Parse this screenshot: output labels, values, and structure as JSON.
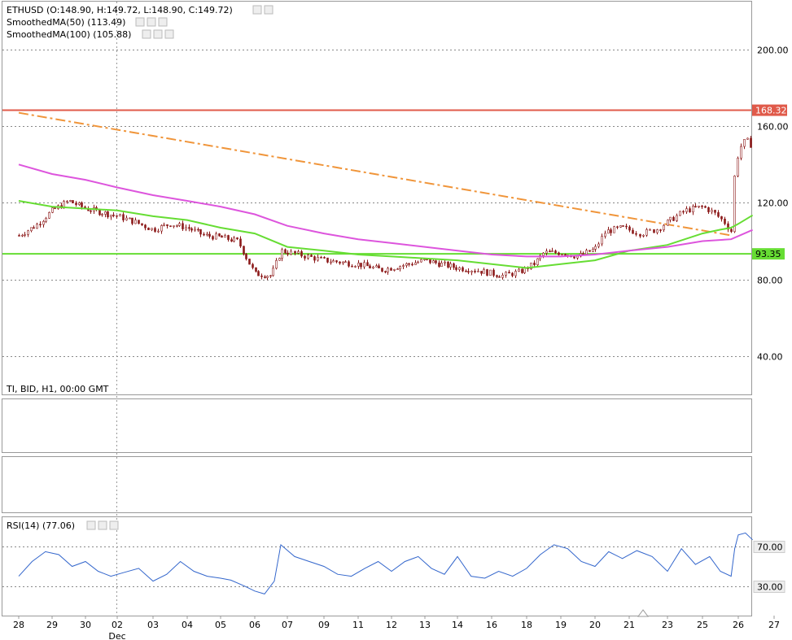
{
  "main_panel": {
    "legend": [
      {
        "text": "ETHUSD (O:148.90, H:149.72, L:148.90, C:149.72)"
      },
      {
        "text": "SmoothedMA(50) (113.49)"
      },
      {
        "text": "SmoothedMA(100) (105.88)"
      }
    ],
    "footer": "TI, BID, H1, 00:00 GMT"
  },
  "rsi_panel": {
    "legend": "RSI(14) (77.06)"
  },
  "colors": {
    "candle": "#8c1a1a",
    "ma50": "#66dd33",
    "ma100": "#dd55dd",
    "trendline": "#f0953a",
    "resistance": "#e05a4a",
    "support": "#66dd33",
    "rsi": "#3366cc",
    "grid": "#888888",
    "frame": "#999999"
  },
  "chart_data": [
    {
      "type": "candlestick",
      "panel": "main",
      "symbol": "ETHUSD",
      "timeframe": "H1",
      "ylim": [
        20,
        225
      ],
      "yticks": [
        40,
        80,
        120,
        160,
        200
      ],
      "ytick_labels": [
        "40.00",
        "80.00",
        "120.00",
        "160.00",
        "200.00"
      ],
      "grid": true,
      "x_dates": [
        "28",
        "29",
        "30",
        "02",
        "03",
        "04",
        "05",
        "06",
        "07",
        "09",
        "11",
        "12",
        "13",
        "14",
        "16",
        "18",
        "19",
        "20",
        "21",
        "23",
        "25",
        "26",
        "27"
      ],
      "x_sublabels": {
        "02": "Dec"
      },
      "price_path": [
        [
          0.0,
          103
        ],
        [
          0.5,
          108
        ],
        [
          1.0,
          116
        ],
        [
          1.5,
          121
        ],
        [
          2.0,
          117
        ],
        [
          2.5,
          115
        ],
        [
          3.0,
          113
        ],
        [
          3.5,
          110
        ],
        [
          4.0,
          106
        ],
        [
          4.5,
          109
        ],
        [
          5.0,
          107
        ],
        [
          5.5,
          103
        ],
        [
          6.0,
          102
        ],
        [
          6.5,
          100
        ],
        [
          7.0,
          83
        ],
        [
          7.5,
          82
        ],
        [
          7.8,
          95
        ],
        [
          8.3,
          93
        ],
        [
          9.0,
          90
        ],
        [
          10.0,
          88
        ],
        [
          10.7,
          85
        ],
        [
          11.5,
          88
        ],
        [
          12.0,
          90
        ],
        [
          13.0,
          86
        ],
        [
          13.5,
          85
        ],
        [
          14.3,
          82
        ],
        [
          14.8,
          84
        ],
        [
          15.2,
          88
        ],
        [
          15.5,
          94
        ],
        [
          16.0,
          94
        ],
        [
          16.5,
          92
        ],
        [
          17.0,
          96
        ],
        [
          17.3,
          105
        ],
        [
          17.8,
          107
        ],
        [
          18.3,
          104
        ],
        [
          18.7,
          106
        ],
        [
          19.0,
          110
        ],
        [
          19.5,
          116
        ],
        [
          20.0,
          118
        ],
        [
          20.3,
          115
        ],
        [
          20.6,
          110
        ],
        [
          20.8,
          105
        ],
        [
          20.85,
          130
        ],
        [
          21.0,
          148
        ],
        [
          21.2,
          153
        ],
        [
          21.4,
          149
        ]
      ],
      "resistance_line": {
        "value": 168.32,
        "label": "168.32"
      },
      "support_line": {
        "value": 93.35,
        "label": "93.35"
      },
      "trendline": {
        "from": [
          0.0,
          167
        ],
        "to": [
          20.8,
          103
        ]
      },
      "series": [
        {
          "name": "SmoothedMA(50)",
          "last": 113.49,
          "points": [
            [
              0.0,
              121
            ],
            [
              1.0,
              118
            ],
            [
              2.0,
              117
            ],
            [
              3.0,
              116
            ],
            [
              4.0,
              113
            ],
            [
              5.0,
              111
            ],
            [
              6.0,
              107
            ],
            [
              7.0,
              104
            ],
            [
              8.0,
              97
            ],
            [
              9.0,
              95
            ],
            [
              10.0,
              93
            ],
            [
              11.0,
              92
            ],
            [
              12.0,
              91
            ],
            [
              13.0,
              90
            ],
            [
              14.0,
              88
            ],
            [
              15.0,
              86
            ],
            [
              16.0,
              88
            ],
            [
              17.0,
              90
            ],
            [
              18.0,
              95
            ],
            [
              19.0,
              98
            ],
            [
              20.0,
              104
            ],
            [
              20.5,
              106
            ],
            [
              20.8,
              107
            ],
            [
              21.0,
              109
            ],
            [
              21.4,
              113.49
            ]
          ]
        },
        {
          "name": "SmoothedMA(100)",
          "last": 105.88,
          "points": [
            [
              0.0,
              140
            ],
            [
              1.0,
              135
            ],
            [
              2.0,
              132
            ],
            [
              3.0,
              128
            ],
            [
              4.0,
              124
            ],
            [
              5.0,
              121
            ],
            [
              6.0,
              118
            ],
            [
              7.0,
              114
            ],
            [
              8.0,
              108
            ],
            [
              9.0,
              104
            ],
            [
              10.0,
              101
            ],
            [
              11.0,
              99
            ],
            [
              12.0,
              97
            ],
            [
              13.0,
              95
            ],
            [
              14.0,
              93
            ],
            [
              15.0,
              92
            ],
            [
              16.0,
              92
            ],
            [
              17.0,
              93
            ],
            [
              18.0,
              95
            ],
            [
              19.0,
              97
            ],
            [
              20.0,
              100
            ],
            [
              20.8,
              101
            ],
            [
              21.4,
              105.88
            ]
          ]
        }
      ]
    },
    {
      "type": "line",
      "panel": "rsi",
      "name": "RSI(14)",
      "last": 77.06,
      "ylim": [
        0,
        100
      ],
      "levels": [
        {
          "value": 70,
          "label": "70.00"
        },
        {
          "value": 30,
          "label": "30.00"
        }
      ],
      "grid": true,
      "points": [
        [
          0.0,
          40
        ],
        [
          0.4,
          55
        ],
        [
          0.8,
          65
        ],
        [
          1.2,
          62
        ],
        [
          1.6,
          50
        ],
        [
          2.0,
          55
        ],
        [
          2.4,
          45
        ],
        [
          2.8,
          40
        ],
        [
          3.2,
          44
        ],
        [
          3.6,
          48
        ],
        [
          4.0,
          35
        ],
        [
          4.4,
          42
        ],
        [
          4.8,
          55
        ],
        [
          5.2,
          45
        ],
        [
          5.6,
          40
        ],
        [
          6.0,
          38
        ],
        [
          6.3,
          36
        ],
        [
          6.7,
          30
        ],
        [
          7.0,
          25
        ],
        [
          7.3,
          22
        ],
        [
          7.6,
          35
        ],
        [
          7.8,
          72
        ],
        [
          8.2,
          60
        ],
        [
          8.6,
          55
        ],
        [
          9.0,
          50
        ],
        [
          9.4,
          42
        ],
        [
          9.8,
          40
        ],
        [
          10.2,
          48
        ],
        [
          10.6,
          55
        ],
        [
          11.0,
          45
        ],
        [
          11.4,
          55
        ],
        [
          11.8,
          60
        ],
        [
          12.2,
          48
        ],
        [
          12.6,
          42
        ],
        [
          13.0,
          60
        ],
        [
          13.4,
          40
        ],
        [
          13.8,
          38
        ],
        [
          14.2,
          45
        ],
        [
          14.6,
          40
        ],
        [
          15.0,
          48
        ],
        [
          15.4,
          62
        ],
        [
          15.8,
          72
        ],
        [
          16.2,
          68
        ],
        [
          16.6,
          55
        ],
        [
          17.0,
          50
        ],
        [
          17.4,
          65
        ],
        [
          17.8,
          58
        ],
        [
          18.2,
          66
        ],
        [
          18.6,
          60
        ],
        [
          19.0,
          45
        ],
        [
          19.4,
          68
        ],
        [
          19.8,
          52
        ],
        [
          20.2,
          60
        ],
        [
          20.5,
          45
        ],
        [
          20.8,
          40
        ],
        [
          20.9,
          68
        ],
        [
          21.0,
          82
        ],
        [
          21.2,
          84
        ],
        [
          21.4,
          77.06
        ]
      ]
    }
  ]
}
